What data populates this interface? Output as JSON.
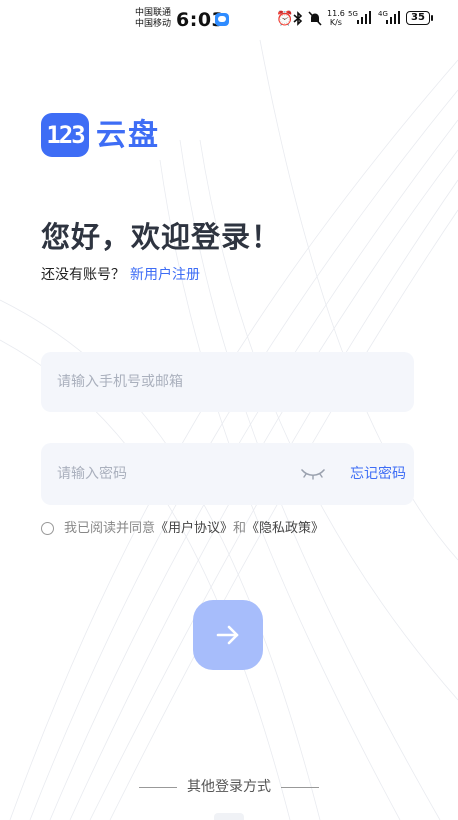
{
  "status_bar": {
    "carrier_1": "中国联通",
    "carrier_2": "中国移动",
    "time": "6:03",
    "net_speed_value": "11.6",
    "net_speed_unit": "K/s",
    "sig1_label": "5G",
    "sig2_label": "4G",
    "battery": "35"
  },
  "brand": {
    "mark": "123",
    "name": "云盘",
    "color": "#3e6df5"
  },
  "greeting": "您好，欢迎登录！",
  "signup": {
    "prompt": "还没有账号？",
    "link": "新用户注册"
  },
  "form": {
    "account_placeholder": "请输入手机号或邮箱",
    "password_placeholder": "请输入密码",
    "forgot_label": "忘记密码"
  },
  "agreement": {
    "prefix": "我已阅读并同意",
    "terms": "《用户协议》",
    "and": "和",
    "privacy": "《隐私政策》",
    "checked": false
  },
  "submit_icon": "arrow-right-icon",
  "other_login_label": "其他登录方式"
}
